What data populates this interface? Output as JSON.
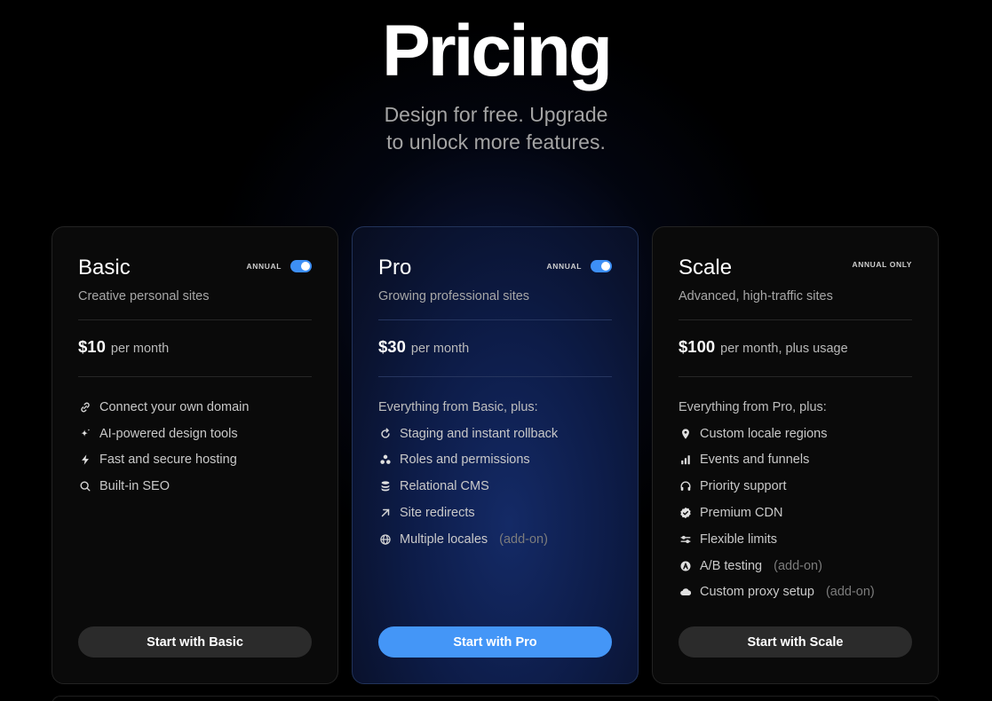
{
  "hero": {
    "title": "Pricing",
    "subtitle_line1": "Design for free. Upgrade",
    "subtitle_line2": "to unlock more features."
  },
  "colors": {
    "background": "#000000",
    "accent": "#4496f7",
    "toggle_on": "#3d8ff5",
    "pro_card": "#0d1c48"
  },
  "plans": {
    "basic": {
      "name": "Basic",
      "description": "Creative personal sites",
      "billing_label": "ANNUAL",
      "annual_toggle_on": true,
      "price": "$10",
      "price_period": "per month",
      "features": [
        {
          "icon": "link-icon",
          "label": "Connect your own domain"
        },
        {
          "icon": "sparkle-icon",
          "label": "AI-powered design tools"
        },
        {
          "icon": "lightning-icon",
          "label": "Fast and secure hosting"
        },
        {
          "icon": "search-icon",
          "label": "Built-in SEO"
        }
      ],
      "cta": "Start with Basic"
    },
    "pro": {
      "name": "Pro",
      "description": "Growing professional sites",
      "billing_label": "ANNUAL",
      "annual_toggle_on": true,
      "price": "$30",
      "price_period": "per month",
      "features_intro": "Everything from Basic, plus:",
      "features": [
        {
          "icon": "rollback-icon",
          "label": "Staging and instant rollback"
        },
        {
          "icon": "roles-icon",
          "label": "Roles and permissions"
        },
        {
          "icon": "database-icon",
          "label": "Relational CMS"
        },
        {
          "icon": "arrow-up-right-icon",
          "label": "Site redirects"
        },
        {
          "icon": "globe-icon",
          "label": "Multiple locales",
          "addon": "(add-on)"
        }
      ],
      "cta": "Start with Pro"
    },
    "scale": {
      "name": "Scale",
      "description": "Advanced, high-traffic sites",
      "billing_label": "ANNUAL ONLY",
      "price": "$100",
      "price_period": "per month, plus usage",
      "features_intro": "Everything from Pro, plus:",
      "features": [
        {
          "icon": "location-pin-icon",
          "label": "Custom locale regions"
        },
        {
          "icon": "bar-chart-icon",
          "label": "Events and funnels"
        },
        {
          "icon": "headphones-icon",
          "label": "Priority support"
        },
        {
          "icon": "verified-badge-icon",
          "label": "Premium CDN"
        },
        {
          "icon": "sliders-icon",
          "label": "Flexible limits"
        },
        {
          "icon": "ab-test-icon",
          "label": "A/B testing",
          "addon": "(add-on)"
        },
        {
          "icon": "cloud-icon",
          "label": "Custom proxy setup",
          "addon": "(add-on)"
        }
      ],
      "cta": "Start with Scale"
    }
  }
}
